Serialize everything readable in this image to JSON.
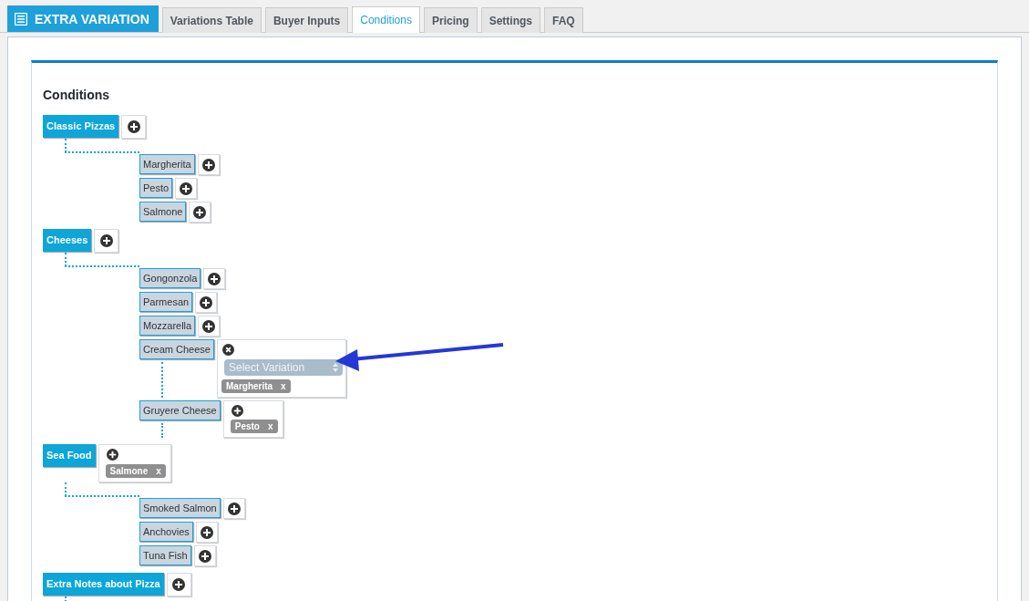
{
  "header": {
    "title": "EXTRA VARIATION"
  },
  "tabs": [
    {
      "label": "Variations Table",
      "selected": false
    },
    {
      "label": "Buyer Inputs",
      "selected": false
    },
    {
      "label": "Conditions",
      "selected": true
    },
    {
      "label": "Pricing",
      "selected": false
    },
    {
      "label": "Settings",
      "selected": false
    },
    {
      "label": "FAQ",
      "selected": false
    }
  ],
  "section_title": "Conditions",
  "groups": [
    {
      "label": "Classic Pizzas",
      "condition": {
        "kind": "add"
      },
      "children": [
        {
          "label": "Margherita",
          "condition": {
            "kind": "add"
          }
        },
        {
          "label": "Pesto",
          "condition": {
            "kind": "add"
          }
        },
        {
          "label": "Salmone",
          "condition": {
            "kind": "add"
          }
        }
      ]
    },
    {
      "label": "Cheeses",
      "condition": {
        "kind": "add"
      },
      "children": [
        {
          "label": "Gongonzola",
          "condition": {
            "kind": "add"
          }
        },
        {
          "label": "Parmesan",
          "condition": {
            "kind": "add"
          }
        },
        {
          "label": "Mozzarella",
          "condition": {
            "kind": "add"
          }
        },
        {
          "label": "Cream Cheese",
          "condition": {
            "kind": "editor",
            "placeholder": "Select Variation",
            "tags": [
              {
                "label": "Margherita",
                "remove": "x"
              }
            ]
          }
        },
        {
          "label": "Gruyere Cheese",
          "condition": {
            "kind": "tags",
            "tags": [
              {
                "label": "Pesto",
                "remove": "x"
              }
            ]
          }
        }
      ]
    },
    {
      "label": "Sea Food",
      "condition": {
        "kind": "tags",
        "tags": [
          {
            "label": "Salmone",
            "remove": "x"
          }
        ]
      },
      "children": [
        {
          "label": "Smoked Salmon",
          "condition": {
            "kind": "add"
          }
        },
        {
          "label": "Anchovies",
          "condition": {
            "kind": "add"
          }
        },
        {
          "label": "Tuna Fish",
          "condition": {
            "kind": "add"
          }
        }
      ]
    },
    {
      "label": "Extra Notes about Pizza",
      "condition": {
        "kind": "add"
      }
    }
  ]
}
